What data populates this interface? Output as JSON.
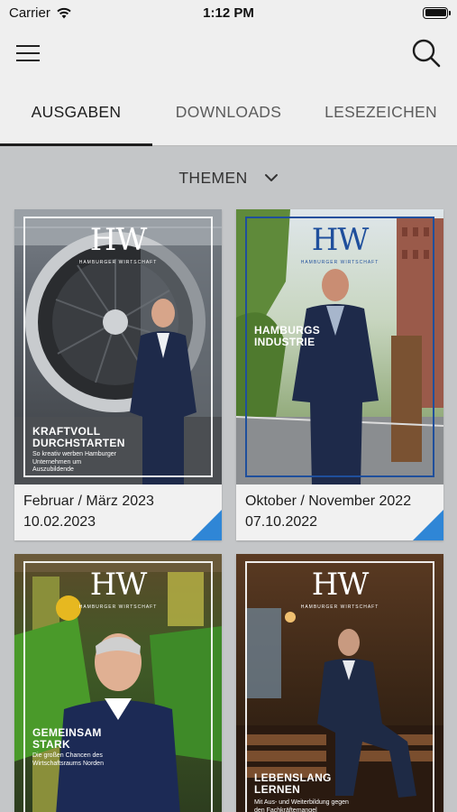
{
  "status": {
    "carrier": "Carrier",
    "time": "1:12 PM"
  },
  "tabs": [
    {
      "label": "AUSGABEN",
      "active": true
    },
    {
      "label": "DOWNLOADS",
      "active": false
    },
    {
      "label": "LESEZEICHEN",
      "active": false
    }
  ],
  "filter": {
    "label": "THEMEN"
  },
  "issues": [
    {
      "title": "Februar / März 2023",
      "date": "10.02.2023",
      "cover_logo": "HW",
      "cover_sub": "HAMBURGER WIRTSCHAFT",
      "headline": "KRAFTVOLL DURCHSTARTEN",
      "subline": "So kreativ werben Hamburger Unternehmen um Auszubildende"
    },
    {
      "title": "Oktober / November 2022",
      "date": "07.10.2022",
      "cover_logo": "HW",
      "cover_sub": "HAMBURGER WIRTSCHAFT",
      "headline": "HAMBURGS INDUSTRIE",
      "subline": ""
    },
    {
      "title": "",
      "date": "",
      "cover_logo": "HW",
      "cover_sub": "HAMBURGER WIRTSCHAFT",
      "headline": "GEMEINSAM STARK",
      "subline": "Die großen Chancen des Wirtschaftsraums Norden"
    },
    {
      "title": "",
      "date": "",
      "cover_logo": "HW",
      "cover_sub": "HAMBURGER WIRTSCHAFT",
      "headline": "LEBENSLANG LERNEN",
      "subline": "Mit Aus- und Weiterbildung gegen den Fachkräftemangel"
    }
  ],
  "colors": {
    "accent": "#2f86d6",
    "logo_blue": "#1f4f9c",
    "background": "#c4c6c8",
    "bar": "#efefef"
  }
}
